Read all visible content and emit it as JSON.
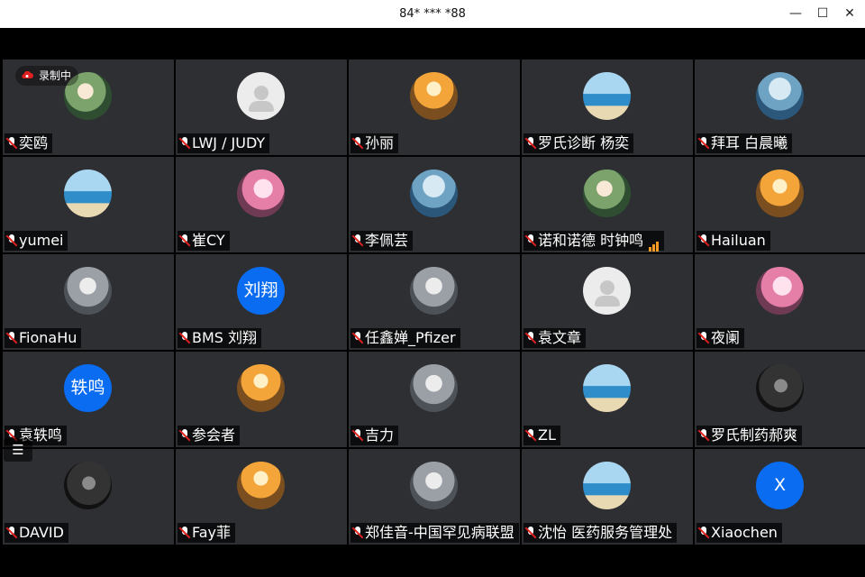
{
  "window": {
    "title": "84* *** *88",
    "controls": [
      {
        "name": "minimize",
        "glyph": "—"
      },
      {
        "name": "maximize",
        "glyph": "☐"
      },
      {
        "name": "close",
        "glyph": "✕"
      }
    ]
  },
  "recording": {
    "label": "录制中",
    "icon": "cloud-record-icon"
  },
  "participants": [
    {
      "name": "奕鸥",
      "avatar": "photo",
      "style": "photo-green",
      "mic": "muted"
    },
    {
      "name": "LWJ / JUDY",
      "avatar": "default",
      "style": "default",
      "mic": "muted"
    },
    {
      "name": "孙丽",
      "avatar": "photo",
      "style": "photo-orange",
      "mic": "muted"
    },
    {
      "name": "罗氏诊断 杨奕",
      "avatar": "photo",
      "style": "photo-sea",
      "mic": "muted"
    },
    {
      "name": "拜耳 白晨曦",
      "avatar": "photo",
      "style": "photo-blue",
      "mic": "muted"
    },
    {
      "name": "yumei",
      "avatar": "photo",
      "style": "photo-sea",
      "mic": "muted"
    },
    {
      "name": "崔CY",
      "avatar": "photo",
      "style": "photo-pink",
      "mic": "muted"
    },
    {
      "name": "李佩芸",
      "avatar": "photo",
      "style": "photo-blue",
      "mic": "muted"
    },
    {
      "name": "诺和诺德 时钟鸣",
      "avatar": "photo",
      "style": "photo-green",
      "mic": "muted",
      "signal": true
    },
    {
      "name": "Hailuan",
      "avatar": "photo",
      "style": "photo-orange",
      "mic": "muted"
    },
    {
      "name": "FionaHu",
      "avatar": "photo",
      "style": "photo-gray",
      "mic": "muted"
    },
    {
      "name": "BMS 刘翔",
      "avatar": "text",
      "avatar_text": "刘翔",
      "style": "text",
      "mic": "muted"
    },
    {
      "name": "任鑫婵_Pfizer",
      "avatar": "photo",
      "style": "photo-gray",
      "mic": "muted"
    },
    {
      "name": "袁文章",
      "avatar": "default",
      "style": "default",
      "mic": "muted"
    },
    {
      "name": "夜阑",
      "avatar": "photo",
      "style": "photo-pink",
      "mic": "muted"
    },
    {
      "name": "袁轶鸣",
      "avatar": "text",
      "avatar_text": "轶鸣",
      "style": "text",
      "mic": "muted"
    },
    {
      "name": "参会者",
      "avatar": "photo",
      "style": "photo-orange",
      "mic": "muted"
    },
    {
      "name": "吉力",
      "avatar": "photo",
      "style": "photo-gray",
      "mic": "muted"
    },
    {
      "name": "ZL",
      "avatar": "photo",
      "style": "photo-sea",
      "mic": "muted"
    },
    {
      "name": "罗氏制药郝爽",
      "avatar": "photo",
      "style": "photo-dark",
      "mic": "muted"
    },
    {
      "name": "DAVID",
      "avatar": "photo",
      "style": "photo-dark",
      "mic": "muted"
    },
    {
      "name": "Fay菲",
      "avatar": "photo",
      "style": "photo-orange",
      "mic": "muted"
    },
    {
      "name": "郑佳音-中国罕见病联盟",
      "avatar": "photo",
      "style": "photo-gray",
      "mic": "muted"
    },
    {
      "name": "沈怡 医药服务管理处",
      "avatar": "photo",
      "style": "photo-sea",
      "mic": "muted"
    },
    {
      "name": "Xiaochen",
      "avatar": "text",
      "avatar_text": "X",
      "style": "text",
      "mic": "muted"
    }
  ],
  "menu_icon": "list-menu-icon"
}
